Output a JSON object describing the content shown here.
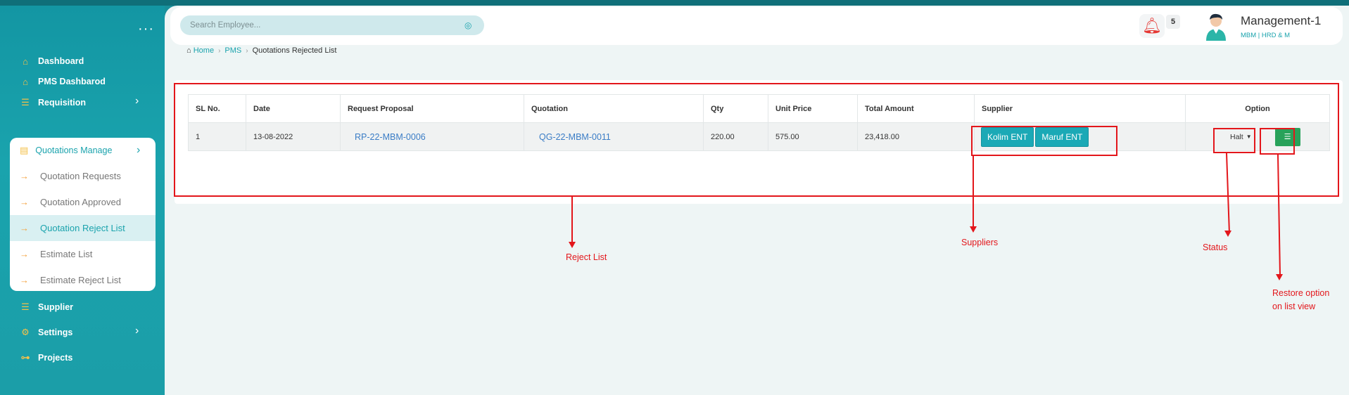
{
  "sidebar": {
    "menu_dots": "···",
    "items": [
      {
        "label": "Dashboard",
        "icon": "home-icon"
      },
      {
        "label": "PMS Dashbarod",
        "icon": "home-icon"
      },
      {
        "label": "Requisition",
        "icon": "list-icon"
      },
      {
        "label": "Supplier",
        "icon": "list-icon"
      },
      {
        "label": "Settings",
        "icon": "gear-icon"
      },
      {
        "label": "Projects",
        "icon": "project-icon"
      }
    ],
    "quotations": {
      "label": "Quotations Manage",
      "children": [
        {
          "label": "Quotation Requests"
        },
        {
          "label": "Quotation Approved"
        },
        {
          "label": "Quotation Reject List",
          "active": true
        },
        {
          "label": "Estimate List"
        },
        {
          "label": "Estimate Reject List"
        }
      ]
    }
  },
  "header": {
    "search_placeholder": "Search Employee...",
    "notification_count": "5",
    "user_name": "Management-1",
    "user_role": "MBM | HRD & M"
  },
  "breadcrumb": {
    "home": "Home",
    "pms": "PMS",
    "current": "Quotations Rejected List"
  },
  "table": {
    "headers": [
      "SL No.",
      "Date",
      "Request Proposal",
      "Quotation",
      "Qty",
      "Unit Price",
      "Total Amount",
      "Supplier",
      "Option"
    ],
    "rows": [
      {
        "sl": "1",
        "date": "13-08-2022",
        "request_proposal": "RP-22-MBM-0006",
        "quotation": "QG-22-MBM-0011",
        "qty": "220.00",
        "unit_price": "575.00",
        "total_amount": "23,418.00",
        "suppliers": [
          "Kolim ENT",
          "Maruf ENT"
        ],
        "status": "Halt"
      }
    ]
  },
  "annotations": {
    "reject_list": "Reject List",
    "suppliers": "Suppliers",
    "status": "Status",
    "restore_line1": "Restore option",
    "restore_line2": "on list view"
  },
  "colors": {
    "sidebar": "#1aa3ad",
    "accent": "#1aa3ad",
    "annotation": "#e3161b",
    "action_button": "#28a25a"
  }
}
